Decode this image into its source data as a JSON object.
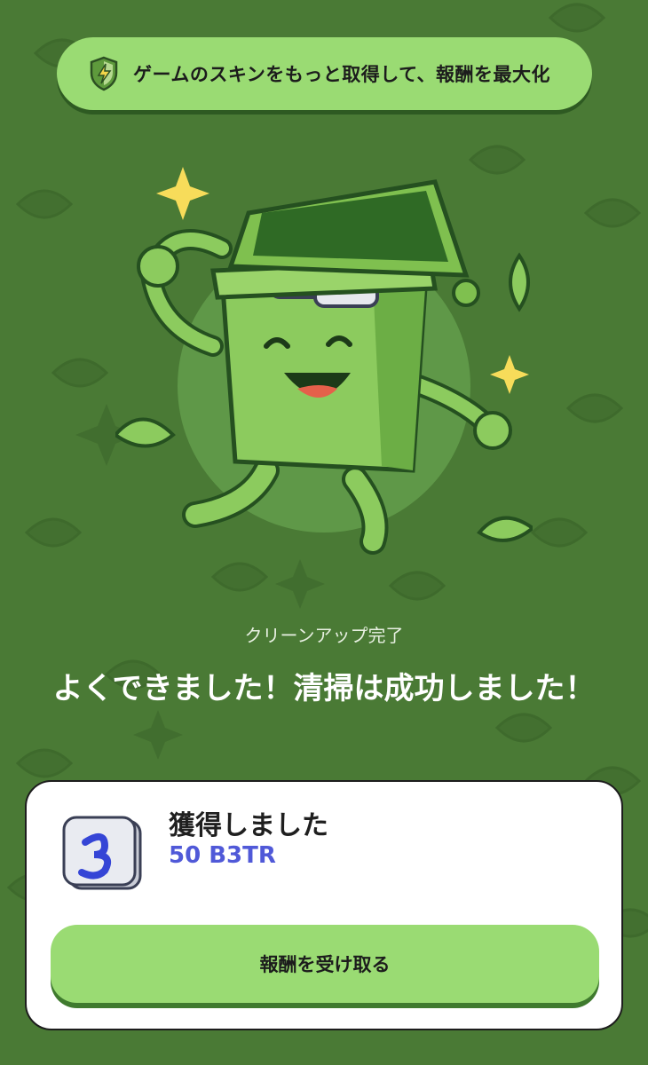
{
  "banner": {
    "icon": "shield-lightning-icon",
    "text": "ゲームのスキンをもっと取得して、報酬を最大化"
  },
  "subtitle": "クリーンアップ完了",
  "headline": "よくできました！清掃は成功しました！",
  "reward": {
    "label": "獲得しました",
    "amount": "50 B3TR",
    "token_icon": "b3tr-token-icon"
  },
  "claim_button": "報酬を受け取る",
  "colors": {
    "background": "#4a7a35",
    "accent_green": "#9adb73",
    "amount_blue": "#5059d8"
  }
}
